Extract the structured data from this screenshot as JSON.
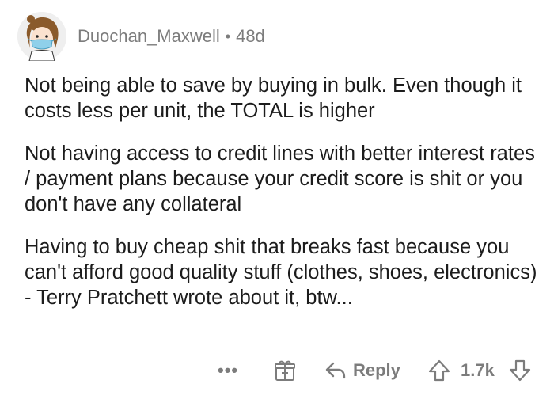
{
  "author": {
    "username": "Duochan_Maxwell",
    "separator": "•",
    "age": "48d",
    "avatar_icon": "avatar-icon"
  },
  "comment": {
    "paragraphs": [
      "Not being able to save by buying in bulk. Even though it costs less per unit, the TOTAL is higher",
      "Not having access to credit lines with better interest rates / payment plans because your credit score is shit or you don't have any collateral",
      "Having to buy cheap shit that breaks fast because you can't afford good quality stuff (clothes, shoes, electronics) - Terry Pratchett wrote about it, btw..."
    ]
  },
  "actions": {
    "more_label": "•••",
    "reply_label": "Reply",
    "score": "1.7k",
    "award_icon": "award-icon",
    "reply_icon": "reply-icon",
    "upvote_icon": "upvote-icon",
    "downvote_icon": "downvote-icon"
  },
  "colors": {
    "meta_gray": "#7c7c7c",
    "text": "#1c1c1c",
    "background": "#ffffff"
  }
}
